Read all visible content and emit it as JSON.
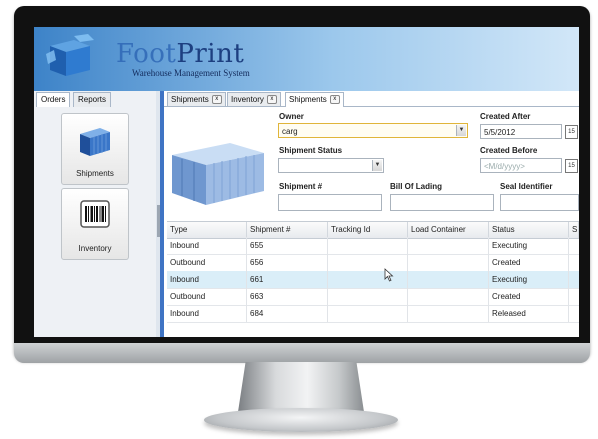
{
  "app": {
    "brand_part1": "Foot",
    "brand_part2": "Print",
    "subtitle": "Warehouse Management System"
  },
  "left_tabs": [
    "Orders",
    "Reports"
  ],
  "nav_buttons": [
    {
      "label": "Shipments",
      "icon": "cargo-container-icon"
    },
    {
      "label": "Inventory",
      "icon": "barcode-icon"
    }
  ],
  "main_tabs": [
    {
      "label": "Shipments",
      "close": "x"
    },
    {
      "label": "Inventory",
      "close": "x"
    },
    {
      "label": "Shipments",
      "close": "x",
      "active": true
    }
  ],
  "filters": {
    "owner_label": "Owner",
    "owner_value": "carg",
    "shipment_status_label": "Shipment Status",
    "shipment_status_value": "",
    "created_after_label": "Created After",
    "created_after_value": "5/5/2012",
    "created_before_label": "Created Before",
    "created_before_placeholder": "<M/d/yyyy>",
    "shipment_no_label": "Shipment #",
    "bill_of_lading_label": "Bill Of Lading",
    "seal_identifier_label": "Seal Identifier",
    "calendar_icon_text": "15"
  },
  "grid": {
    "columns": [
      "Type",
      "Shipment #",
      "Tracking Id",
      "Load Container",
      "Status",
      "S"
    ],
    "rows": [
      {
        "type": "Inbound",
        "shipment": "655",
        "tracking": "",
        "container": "",
        "status": "Executing"
      },
      {
        "type": "Outbound",
        "shipment": "656",
        "tracking": "",
        "container": "",
        "status": "Created"
      },
      {
        "type": "Inbound",
        "shipment": "661",
        "tracking": "",
        "container": "",
        "status": "Executing",
        "selected": true
      },
      {
        "type": "Outbound",
        "shipment": "663",
        "tracking": "",
        "container": "",
        "status": "Created"
      },
      {
        "type": "Inbound",
        "shipment": "684",
        "tracking": "",
        "container": "",
        "status": "Released"
      }
    ]
  },
  "colors": {
    "header_blue": "#3d83c8",
    "brand_text": "#1d3f80",
    "selected_row": "#daeef8",
    "focus_border": "#e0b53a"
  }
}
